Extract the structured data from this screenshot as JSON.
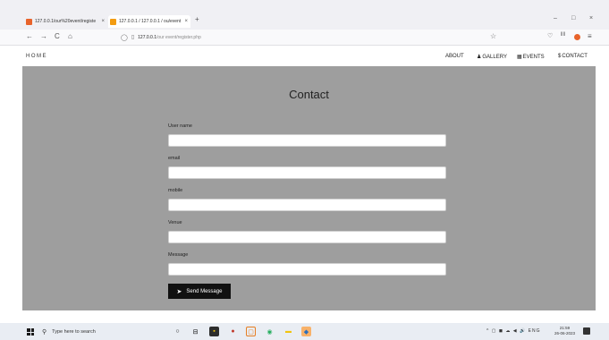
{
  "browser": {
    "tabs": [
      {
        "label": "127.0.0.1/our%20event/registe",
        "favicon": "orange-page-icon",
        "close": "×"
      },
      {
        "label": "127.0.0.1 / 127.0.0.1 / ou/event",
        "favicon": "phpmyadmin-icon",
        "close": "×"
      }
    ],
    "new_tab": "+",
    "window_controls": {
      "minimize": "–",
      "maximize": "□",
      "close": "×"
    },
    "nav": {
      "back": "←",
      "forward": "→",
      "reload": "C",
      "home": "⌂"
    },
    "url": {
      "host": "127.0.0.1",
      "path": "/our event/register.php"
    }
  },
  "site": {
    "home": "HOME",
    "nav": [
      {
        "label": "ABOUT",
        "icon": ""
      },
      {
        "label": "GALLERY",
        "icon": "user-icon"
      },
      {
        "label": "EVENTS",
        "icon": "grid-icon"
      },
      {
        "label": "CONTACT",
        "icon": "dollar-icon"
      }
    ]
  },
  "form": {
    "title": "Contact",
    "fields": [
      {
        "label": "User name",
        "value": ""
      },
      {
        "label": "email",
        "value": ""
      },
      {
        "label": "mobile",
        "value": ""
      },
      {
        "label": "Venue",
        "value": ""
      },
      {
        "label": "Message",
        "value": ""
      }
    ],
    "submit": "Send Message"
  },
  "taskbar": {
    "search_placeholder": "Type here to search",
    "tray": "ENG",
    "time": "21:59",
    "date": "26-06-2023"
  },
  "colors": {
    "content_bg": "#9e9e9e",
    "button_bg": "#111111",
    "page_bg": "#ffffff"
  }
}
